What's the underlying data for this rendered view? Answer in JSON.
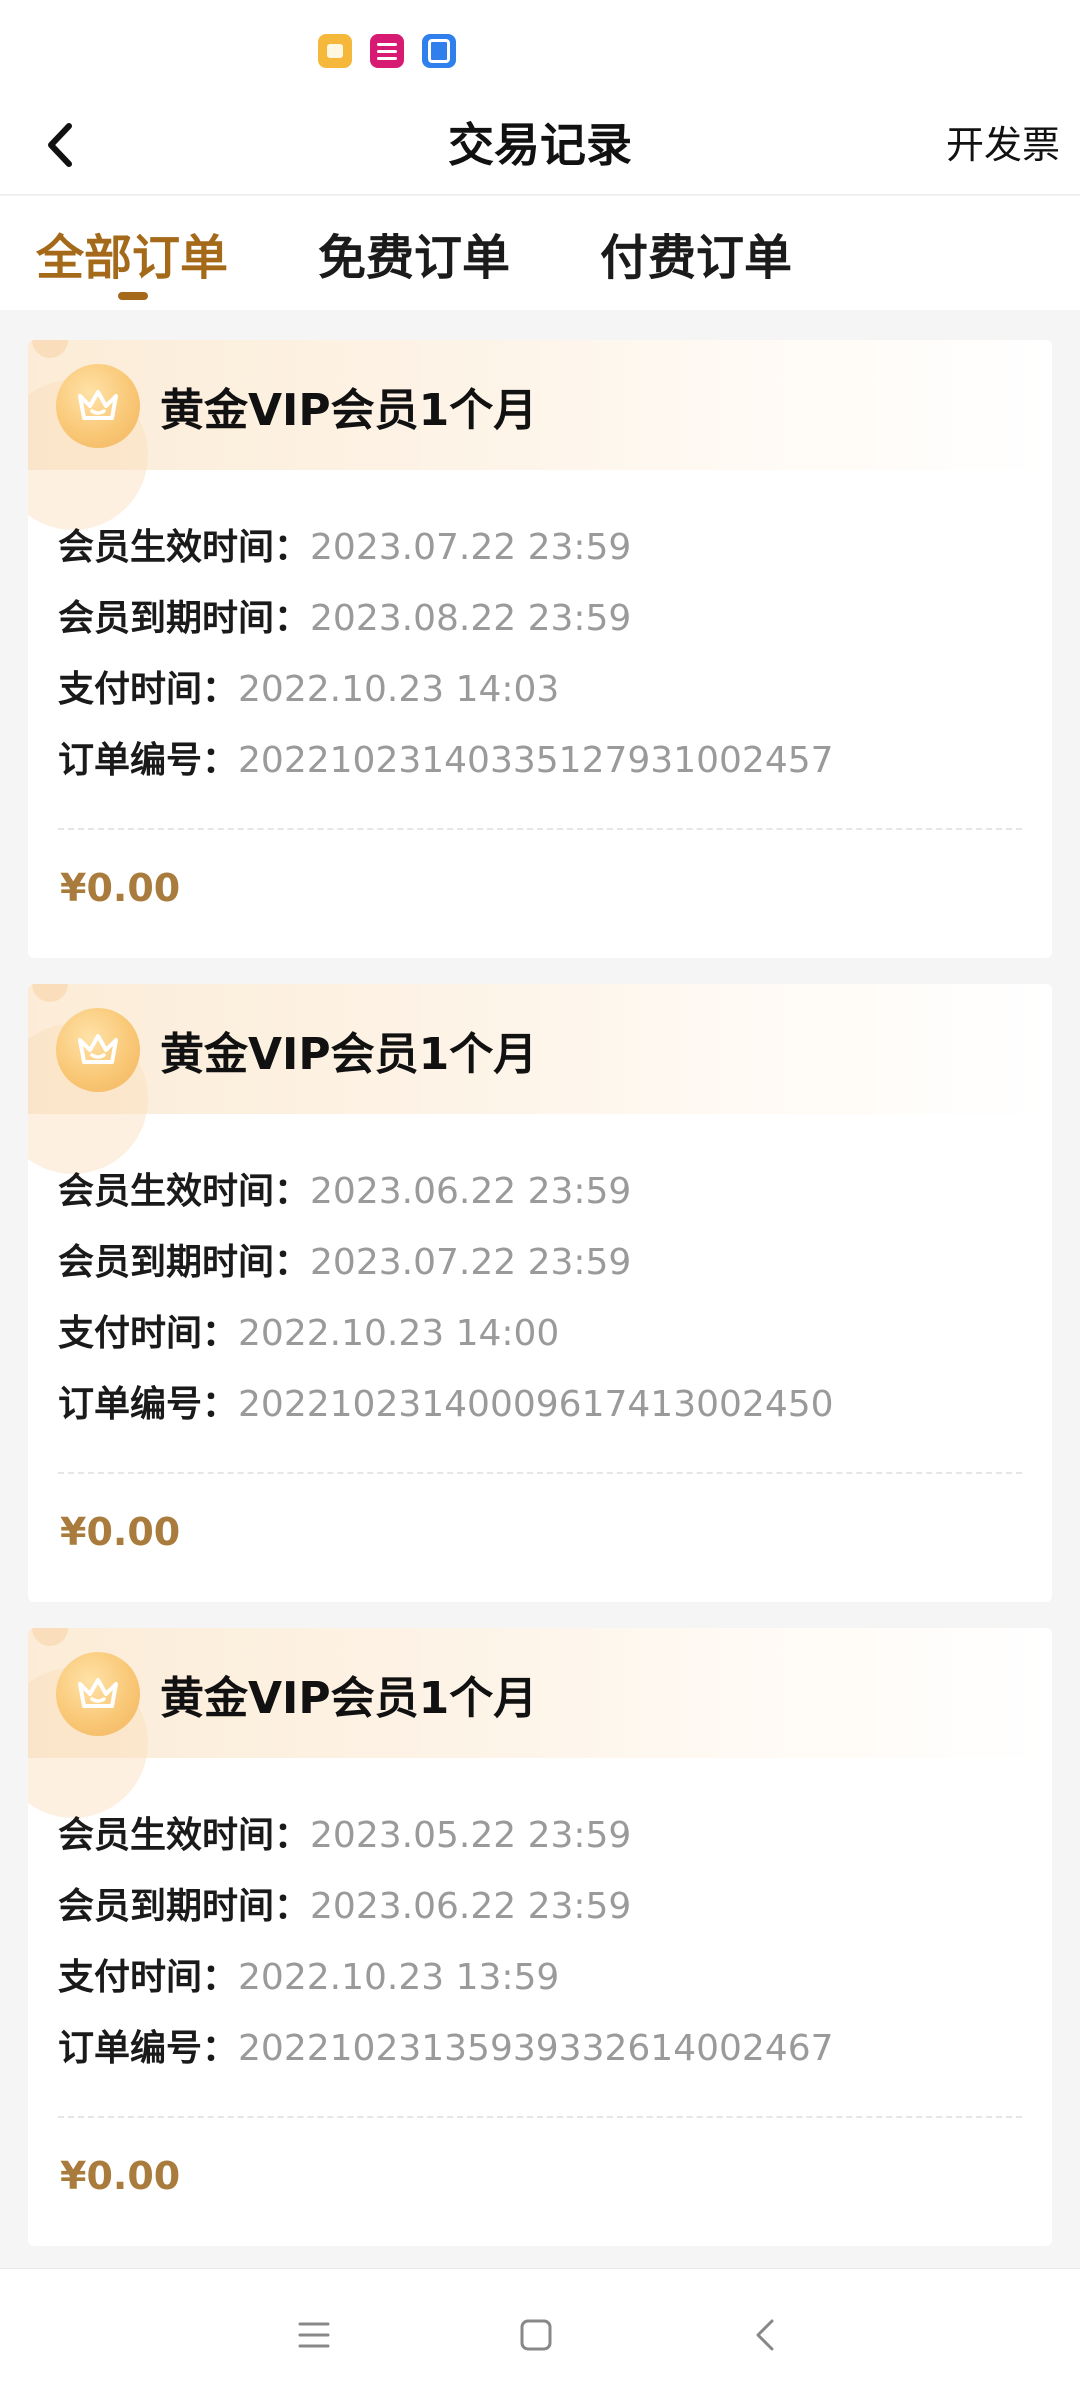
{
  "header": {
    "title": "交易记录",
    "invoice_label": "开发票"
  },
  "tabs": [
    {
      "label": "全部订单",
      "active": true
    },
    {
      "label": "免费订单",
      "active": false
    },
    {
      "label": "付费订单",
      "active": false
    }
  ],
  "orders": [
    {
      "title": "黄金VIP会员1个月",
      "effective_label": "会员生效时间：",
      "effective_value": "2023.07.22 23:59",
      "expire_label": "会员到期时间：",
      "expire_value": "2023.08.22 23:59",
      "pay_label": "支付时间：",
      "pay_value": "2022.10.23 14:03",
      "order_label": "订单编号：",
      "order_value": "20221023140335127931002457",
      "price": "¥0.00"
    },
    {
      "title": "黄金VIP会员1个月",
      "effective_label": "会员生效时间：",
      "effective_value": "2023.06.22 23:59",
      "expire_label": "会员到期时间：",
      "expire_value": "2023.07.22 23:59",
      "pay_label": "支付时间：",
      "pay_value": "2022.10.23 14:00",
      "order_label": "订单编号：",
      "order_value": "20221023140009617413002450",
      "price": "¥0.00"
    },
    {
      "title": "黄金VIP会员1个月",
      "effective_label": "会员生效时间：",
      "effective_value": "2023.05.22 23:59",
      "expire_label": "会员到期时间：",
      "expire_value": "2023.06.22 23:59",
      "pay_label": "支付时间：",
      "pay_value": "2022.10.23 13:59",
      "order_label": "订单编号：",
      "order_value": "20221023135939332614002467",
      "price": "¥0.00"
    }
  ],
  "icons": {
    "back": "chevron-left-icon",
    "order_badge": "crown-icon",
    "nav_menu": "menu-icon",
    "nav_home": "home-square-icon",
    "nav_back": "back-triangle-icon"
  },
  "colors": {
    "accent": "#a46a1a",
    "price": "#a97b3c",
    "value_text": "#9a9a9a",
    "background": "#f5f5f5"
  }
}
